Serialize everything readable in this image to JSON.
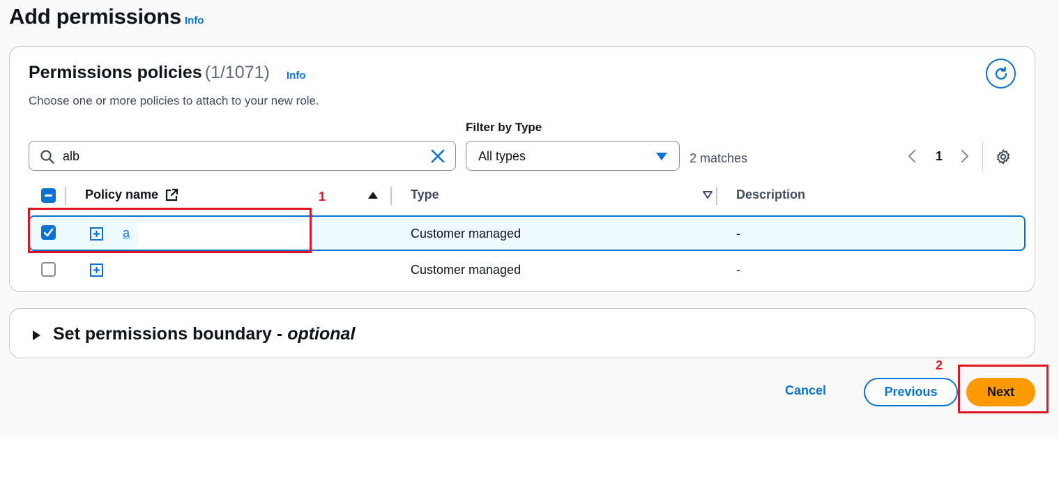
{
  "page": {
    "title": "Add permissions",
    "info_label": "Info"
  },
  "policies": {
    "title": "Permissions policies",
    "count": "(1/1071)",
    "info_label": "Info",
    "description": "Choose one or more policies to attach to your new role.",
    "filter_label": "Filter by Type",
    "search": {
      "value": "alb",
      "placeholder": ""
    },
    "type_filter": {
      "selected": "All types"
    },
    "matches": "2 matches",
    "pagination": {
      "current_page": "1"
    },
    "columns": {
      "policy_name": "Policy name",
      "type": "Type",
      "description": "Description"
    },
    "rows": [
      {
        "selected": true,
        "policy_name": "a",
        "type": "Customer managed",
        "description": "-"
      },
      {
        "selected": false,
        "policy_name": "",
        "type": "Customer managed",
        "description": "-"
      }
    ]
  },
  "boundary": {
    "title": "Set permissions boundary - ",
    "title_optional": "optional"
  },
  "footer": {
    "cancel_label": "Cancel",
    "previous_label": "Previous",
    "next_label": "Next"
  },
  "annotations": {
    "marker_1": "1",
    "marker_2": "2",
    "color": "#e0161e"
  },
  "colors": {
    "link_blue": "#0972d3",
    "primary_orange": "#ff9900",
    "selected_row_bg": "#f0fbff"
  },
  "icons": [
    "search-icon",
    "clear-icon",
    "refresh-icon",
    "caret-down-icon",
    "chevron-left-icon",
    "chevron-right-icon",
    "settings-icon",
    "external-link-icon",
    "sort-ascending-icon",
    "sort-descending-icon",
    "expand-icon",
    "caret-right-icon"
  ]
}
